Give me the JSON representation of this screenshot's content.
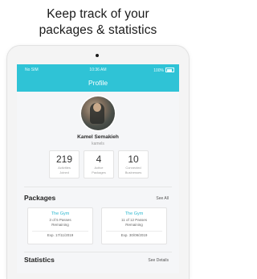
{
  "headline": {
    "line1": "Keep track of your",
    "line2": "packages & statistics"
  },
  "status_bar": {
    "carrier": "No SIM",
    "time": "10:36 AM",
    "battery": "100%"
  },
  "nav": {
    "title": "Profile"
  },
  "profile": {
    "name": "Kamel Semakieh",
    "username": "kamels"
  },
  "stats": [
    {
      "value": "219",
      "label_line1": "Activities",
      "label_line2": "Joined"
    },
    {
      "value": "4",
      "label_line1": "Active",
      "label_line2": "Packages"
    },
    {
      "value": "10",
      "label_line1": "Connected",
      "label_line2": "Businesses"
    }
  ],
  "packages": {
    "title": "Packages",
    "see_all": "See All",
    "items": [
      {
        "name": "The Gym",
        "remaining_line1": "3 of 5 Passes",
        "remaining_line2": "Remaining",
        "expiry": "Exp. 17/11/2019"
      },
      {
        "name": "The Gym",
        "remaining_line1": "11 of 12 Passes",
        "remaining_line2": "Remaining",
        "expiry": "Exp. 30/09/2019"
      }
    ]
  },
  "statistics": {
    "title": "Statistics",
    "see_details": "See Details"
  },
  "colors": {
    "accent": "#2fc3d6",
    "package_name": "#2fb8cf"
  }
}
